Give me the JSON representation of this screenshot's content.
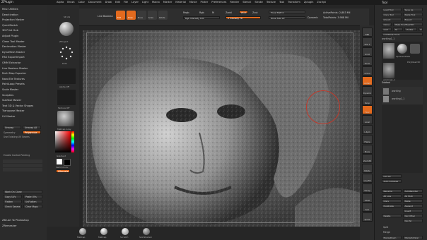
{
  "app": {
    "name": "ZPlugin"
  },
  "menubar": [
    "Alpha",
    "Brush",
    "Color",
    "Document",
    "Draw",
    "Edit",
    "File",
    "Layer",
    "Light",
    "Macro",
    "Marker",
    "Material",
    "Movie",
    "Picker",
    "Preferences",
    "Render",
    "Stencil",
    "Stroke",
    "Texture",
    "Tool",
    "Transform",
    "Zplugin",
    "Zscript"
  ],
  "menubar_right": "Tool",
  "infobar": {
    "text": "0.995 4.226 -0.798"
  },
  "left_menu": [
    "Misc Utilities",
    "Deactivation",
    "Projection Master",
    "QuickSketch",
    "3D Print Hub",
    "Adjust Plugin",
    "Clean Tool Master",
    "Decimation Master",
    "DynaMesh Master",
    "FBX ExportImport",
    "GMM Extractor",
    "Live Boolean Master",
    "Multi Map Exporter",
    "NanoTile Textures",
    "PaintLoop Presets",
    "Scale Master",
    "Sculpties",
    "SubTool Master",
    "Text 3D & Vector Shapes",
    "Transpose Master",
    "UV Master"
  ],
  "uvmaster": {
    "unwrap": "Unwrap",
    "unwrap_all": "Unwrap All",
    "symmetry": "Symmetry",
    "polygroups": "Polygroups",
    "use_existing": "Use Existing UV Seams",
    "enable_control": "Enable Control Painting",
    "work_on_clone": "Work On Clone",
    "copy_uvs": "Copy UVs",
    "paste_uvs": "Paste UVs",
    "flatten": "Flatten",
    "unflatten": "UnFlatten",
    "check_seams": "Check Seams",
    "clear_maps": "Clear Maps"
  },
  "left_bottom": [
    "ZBrush To Photoshop",
    "ZRemesher"
  ],
  "toolcol": {
    "size_label": "SD  AS",
    "brush": "ZProject",
    "stroke": "Dots",
    "alpha": "Alpha Off",
    "texture": "Texture Off",
    "material": "MatCap Gray",
    "gradient": "Gradient",
    "switch_color": "SwitchColor",
    "alternate": "Alternate"
  },
  "toptool": {
    "live_boolean": "Live Boolean",
    "edit": "Edit",
    "draw": "Draw",
    "move": "Move",
    "scale": "Scale",
    "rotate": "Rotate",
    "mrgb": "Mrgb",
    "rgb": "Rgb",
    "m": "M",
    "zadd": "Zadd",
    "zsub": "Zsub",
    "zcut": "Zcut",
    "rgb_intensity": "Rgb Intensity 100",
    "z_intensity": "Z Intensity 78",
    "focal_shift": "Focal Shift 0",
    "draw_size": "Draw Size 22",
    "dynamic": "Dynamic",
    "active_points": "ActivePoints: 2,883 Mil",
    "total_points": "TotalPoints: 3.988 Mil"
  },
  "right_shelf": [
    "BPR",
    "SPix 3",
    "Scroll",
    "Zoom",
    "Actual",
    "AAHalf",
    "Dynamic",
    "Persp",
    "Floor",
    "Local",
    "L.Sym",
    "Frame",
    "Move",
    "Zoom3D",
    "Rotate",
    "Line Fill",
    "Transp",
    "Ghost",
    "Solo",
    "Xpose"
  ],
  "right_palette": {
    "load_tool": "Load Tool",
    "save_as": "Save As",
    "copy_tool": "Copy Tool",
    "paste_tool": "Paste Tool",
    "import": "Import",
    "export": "Export",
    "clone": "Clone",
    "make_polymesh": "Make PolyMesh3D",
    "goz": "GoZ",
    "all": "All",
    "visible": "Visible",
    "r": "R",
    "lightbox": "Lightbox▸ Tools",
    "tool_name": "working1_1",
    "tools": [
      "working1_1",
      "SphereInflate",
      "PolyMesh3D"
    ],
    "subtool": "Subtool",
    "subtool_items": [
      "working",
      "working1_1"
    ],
    "list_all": "List All",
    "auto_collapse": "Auto Collapse",
    "rename": "Rename",
    "autoreorder": "AutoReorder",
    "all_low": "All Low",
    "all_high": "All High",
    "copy": "Copy",
    "paste": "Paste",
    "duplicate": "Duplicate",
    "append": "Append",
    "insert": "Insert",
    "delete": "Delete",
    "del_other": "Del Other",
    "del_all": "Del All",
    "split": "Split",
    "merge": "Merge",
    "merge_down": "MergeDown",
    "merge_similar": "MergeSimilar"
  },
  "bottom_shelf": [
    "MatCap",
    "MatCap",
    "Scratch",
    "SkinShade4"
  ],
  "colors": {
    "accent": "#e36a1e",
    "bg": "#262626",
    "panel": "#2b2b2b"
  }
}
